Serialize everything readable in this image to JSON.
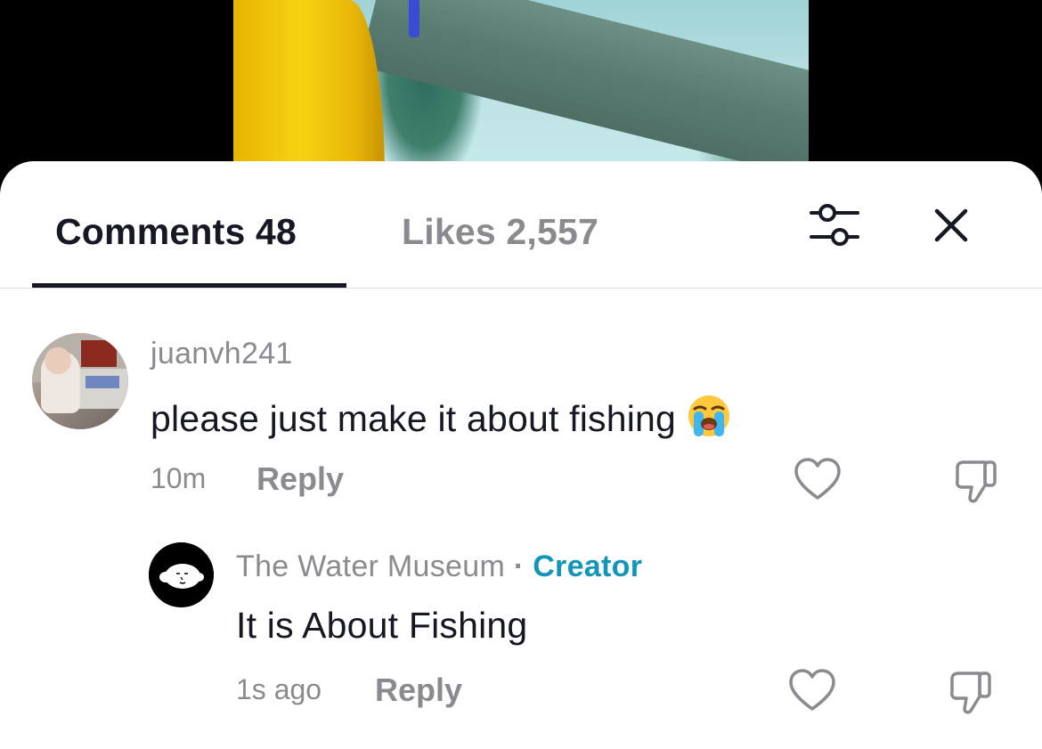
{
  "tabs": {
    "comments_label": "Comments 48",
    "likes_label": "Likes 2,557"
  },
  "icons": {
    "filter": "sliders-icon",
    "close": "close-icon",
    "like": "heart-outline-icon",
    "dislike": "thumbs-down-icon",
    "emoji": "loudly-crying-face-emoji"
  },
  "colors": {
    "text_primary": "#161823",
    "text_secondary": "#8a8b91",
    "creator_accent": "#1296b8"
  },
  "comments": [
    {
      "username": "juanvh241",
      "text": "please just make it about fishing",
      "time": "10m",
      "reply_label": "Reply",
      "replies": [
        {
          "username": "The Water Museum",
          "separator": "·",
          "badge": "Creator",
          "text": "It is About Fishing",
          "time": "1s ago",
          "reply_label": "Reply"
        }
      ]
    }
  ]
}
